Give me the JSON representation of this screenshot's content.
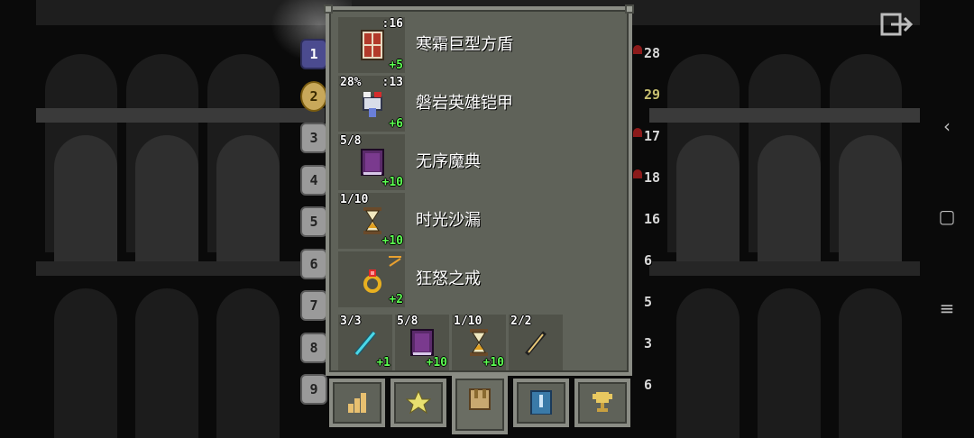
{
  "depth_tabs": [
    "1",
    "2",
    "3",
    "4",
    "5",
    "6",
    "7",
    "8",
    "9"
  ],
  "right_indicators": [
    "28",
    "29",
    "17",
    "18",
    "16",
    "6",
    "5",
    "3",
    "6"
  ],
  "equipment": [
    {
      "name": "寒霜巨型方盾",
      "top_left": "",
      "top_right": ":16",
      "bonus": "+5",
      "icon": "shield-icon"
    },
    {
      "name": "磐岩英雄铠甲",
      "top_left": "28%",
      "top_right": ":13",
      "bonus": "+6",
      "icon": "armor-icon"
    },
    {
      "name": "无序魔典",
      "top_left": "5/8",
      "top_right": "",
      "bonus": "+10",
      "icon": "spellbook-icon"
    },
    {
      "name": "时光沙漏",
      "top_left": "1/10",
      "top_right": "",
      "bonus": "+10",
      "icon": "hourglass-icon"
    },
    {
      "name": "狂怒之戒",
      "top_left": "",
      "top_right": "",
      "bonus": "+2",
      "icon": "ring-icon"
    }
  ],
  "bag": [
    {
      "top_left": "3/3",
      "bonus": "+1",
      "icon": "wand-icon"
    },
    {
      "top_left": "5/8",
      "bonus": "+10",
      "icon": "spellbook-icon"
    },
    {
      "top_left": "1/10",
      "bonus": "+10",
      "icon": "hourglass-icon"
    },
    {
      "top_left": "2/2",
      "bonus": "",
      "icon": "dart-icon"
    }
  ],
  "tabs": [
    {
      "icon": "stats-icon",
      "active": false
    },
    {
      "icon": "badges-icon",
      "active": false
    },
    {
      "icon": "inventory-icon",
      "active": true
    },
    {
      "icon": "journal-icon",
      "active": false
    },
    {
      "icon": "trophy-icon",
      "active": false
    }
  ],
  "system_nav": {
    "back": "‹",
    "home": "▢",
    "menu": "≡"
  },
  "colors": {
    "bonus": "#5dff52",
    "panel": "#5f6259",
    "panel_border": "#8a8c84"
  }
}
